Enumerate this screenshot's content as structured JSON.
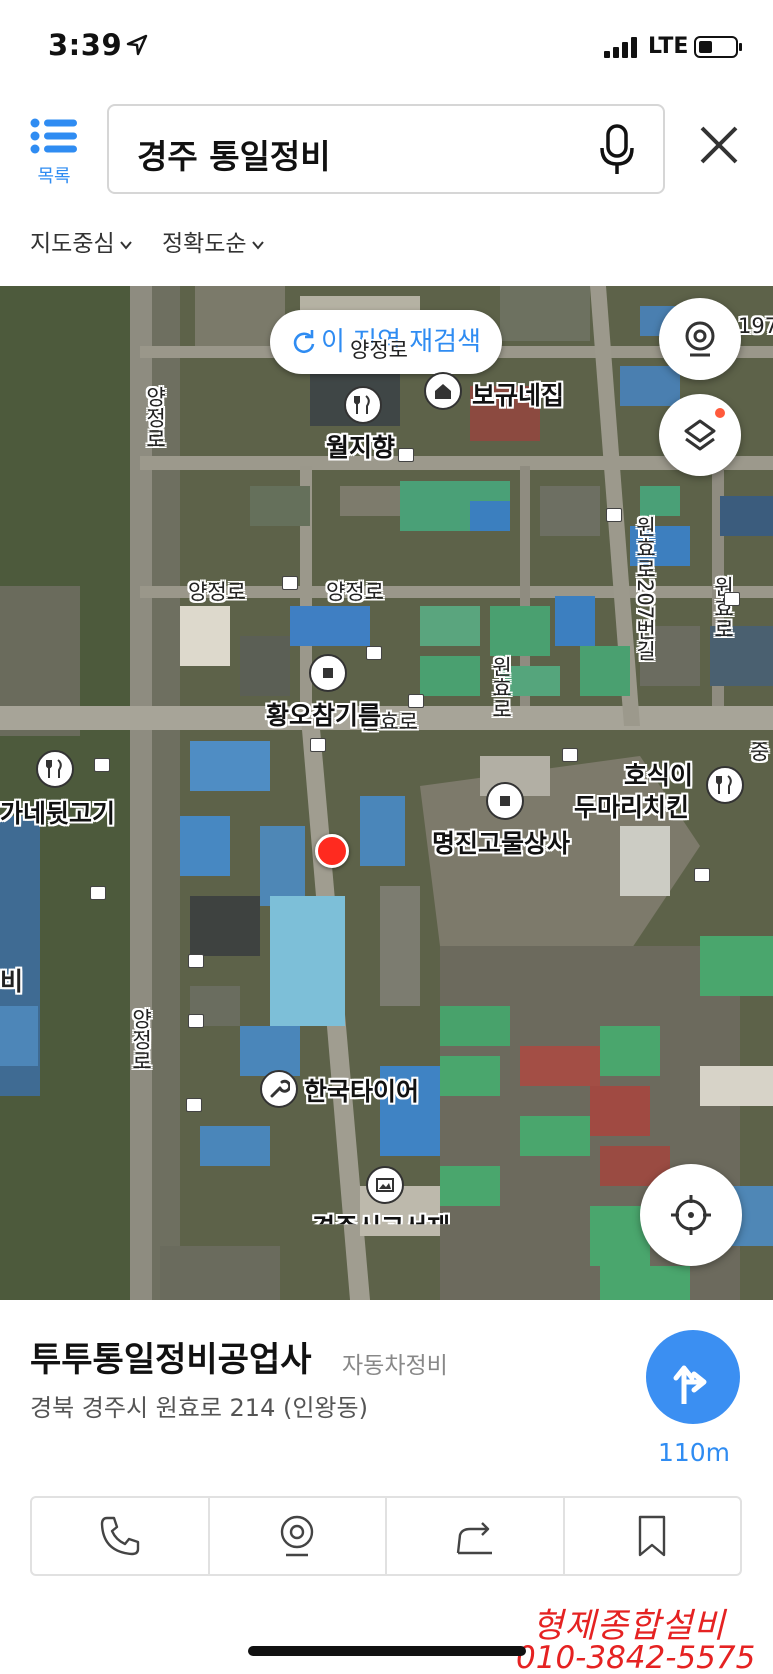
{
  "status_bar": {
    "time": "3:39",
    "network": "LTE"
  },
  "header": {
    "list_label": "목록",
    "search_query": "경주 통일정비",
    "filters": [
      "지도중심",
      "정확도순"
    ]
  },
  "map": {
    "rescan_label": "이 지역 재검색",
    "pois": [
      {
        "name": "보규네집",
        "icon": "house-icon"
      },
      {
        "name": "월지향",
        "icon": "restaurant-icon"
      },
      {
        "name": "황오참기름",
        "icon": "shop-icon"
      },
      {
        "name": "가네뒷고기",
        "icon": "restaurant-icon"
      },
      {
        "name": "명진고물상사",
        "icon": "shop-icon"
      },
      {
        "name": "호식이\n두마리치킨",
        "icon": "restaurant-icon"
      },
      {
        "name": "한국타이어",
        "icon": "wrench-icon"
      },
      {
        "name": "경주시고서재",
        "icon": "gallery-icon"
      }
    ],
    "poi_line_1": "호식이",
    "poi_line_2": "두마리치킨",
    "road_labels": [
      "양정로",
      "양정로",
      "양정로",
      "양정로",
      "원효로207번길",
      "원효로",
      "원효로",
      "양정로",
      "원효로"
    ],
    "edge_labels": [
      "197",
      "중",
      "비"
    ]
  },
  "place_card": {
    "name": "투투통일정비공업사",
    "category": "자동차정비",
    "address": "경북 경주시 원효로 214 (인왕동)",
    "distance": "110m",
    "actions": [
      "phone-icon",
      "roadview-icon",
      "share-icon",
      "bookmark-icon"
    ]
  },
  "watermark": {
    "line1": "형제종합설비",
    "line2": "010-3842-5575"
  },
  "colors": {
    "accent": "#2f8cf2",
    "marker": "#ff2a1f",
    "watermark": "#e52222"
  }
}
